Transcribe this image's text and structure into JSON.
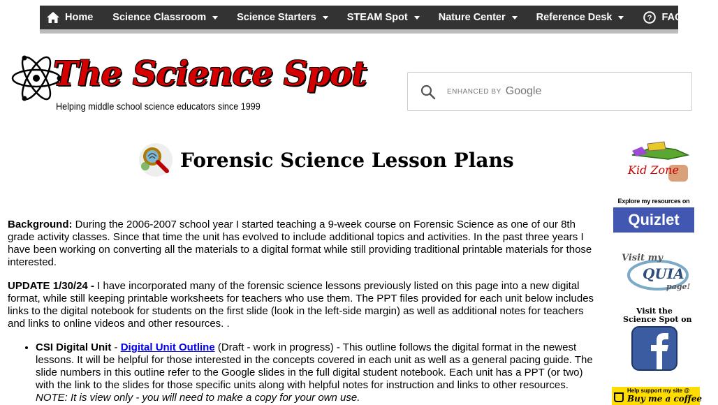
{
  "nav": {
    "items": [
      {
        "label": "Home",
        "icon": "home-icon",
        "dropdown": false
      },
      {
        "label": "Science Classroom",
        "dropdown": true
      },
      {
        "label": "Science Starters",
        "dropdown": true
      },
      {
        "label": "STEAM Spot",
        "dropdown": true
      },
      {
        "label": "Nature Center",
        "dropdown": true
      },
      {
        "label": "Reference Desk",
        "dropdown": true
      },
      {
        "label": "FAQs",
        "icon": "help-icon",
        "dropdown": false
      }
    ]
  },
  "logo": {
    "title": "The Science Spot",
    "subtitle": "Helping middle school science educators since 1999"
  },
  "search": {
    "enhanced_label": "ENHANCED BY",
    "brand": "Google",
    "value": ""
  },
  "page": {
    "title": "Forensic Science Lesson Plans"
  },
  "sidebar": {
    "kidzone": "Kid Zone",
    "quizlet_top": "Explore my resources on",
    "quizlet_brand": "Quizlet",
    "quia_top": "Visit my",
    "quia_brand": "QUIA",
    "quia_bottom": "page!",
    "fb_top": "Visit the",
    "fb_mid": "Science Spot on",
    "coffee_top": "Help support my site @",
    "coffee_brand": "Buy me a coffee"
  },
  "content": {
    "bg_label": "Background:",
    "bg_text": " During the 2006-2007 school year I started teaching a 9-week course on Forensic Science as one of our 8th grade activity classes.  Since that time the unit has evolved to include additional topics and activities. In the past three years I have been working on converting all the materials to a digital format while still providing traditional printable materials for those interested.",
    "update_label": "UPDATE 1/30/24 - ",
    "update_text": "I have incorporated many of the forensic science lessons previously listed on this page into a new digital format, while still keeping printable worksheets for teachers who use them.  The PPT files provided for each unit below includes links to the digital notebook for students on the first slide (look in the left-side margin) as well as additional notes for teachers and links to online videos and other resources.  .",
    "csi_label": "CSI Digital Unit",
    "csi_dash": " - ",
    "csi_link": "Digital Unit Outline",
    "csi_text": " (Draft - work in progress) - This outline follows the digital format in the newest lessons.  It will be helpful for those interested in the concepts covered in each unit as well as a general pacing guide.  The slide numbers in this outline refer to the Google slides in the full digital student notebook. Each unit has a PPT (or two) with the link to the slides for those specific units along with helpful notes for instruction and links to other resources.  ",
    "csi_note": "NOTE:  It is view only - you will need to make a copy for your own use."
  }
}
